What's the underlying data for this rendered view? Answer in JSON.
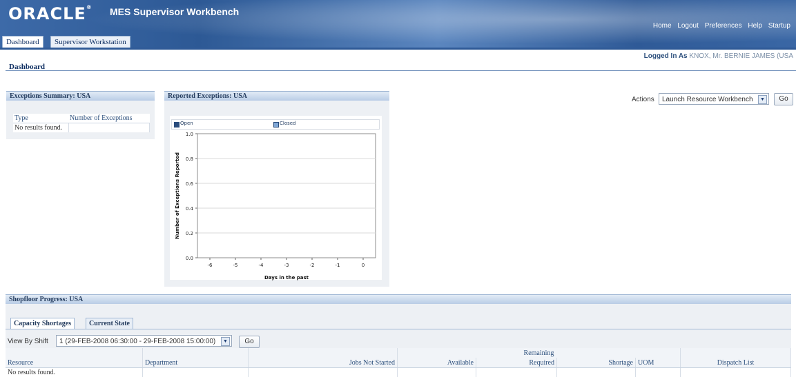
{
  "header": {
    "logo": "ORACLE",
    "app_title": "MES Supervisor Workbench",
    "links": [
      "Home",
      "Logout",
      "Preferences",
      "Help",
      "Startup"
    ]
  },
  "tabs": [
    {
      "label": "Dashboard"
    },
    {
      "label": "Supervisor Workstation"
    }
  ],
  "logged_in": {
    "label": "Logged In As",
    "user": "KNOX, Mr. BERNIE JAMES (USA"
  },
  "page_title": "Dashboard",
  "actions": {
    "label": "Actions",
    "selected": "Launch Resource Workbench",
    "go": "Go"
  },
  "exceptions_summary": {
    "title": "Exceptions Summary: USA",
    "columns": [
      "Type",
      "Number of Exceptions"
    ],
    "empty": "No results found."
  },
  "reported_exceptions": {
    "title": "Reported Exceptions: USA"
  },
  "chart_data": {
    "type": "line",
    "legend": [
      "Open",
      "Closed"
    ],
    "series": [
      {
        "name": "Open",
        "values": []
      },
      {
        "name": "Closed",
        "values": []
      }
    ],
    "x": [
      -6,
      -5,
      -4,
      -3,
      -2,
      -1,
      0
    ],
    "x_tick_labels": [
      "-6",
      "-5",
      "-4",
      "-3",
      "-2",
      "-1",
      "0"
    ],
    "y_tick_labels": [
      "0.0",
      "0.2",
      "0.4",
      "0.6",
      "0.8",
      "1.0"
    ],
    "ylim": [
      0.0,
      1.0
    ],
    "xlabel": "Days in the past",
    "ylabel": "Number of Exceptions Reported",
    "grid": true,
    "legend_position": "top"
  },
  "shopfloor": {
    "title": "Shopfloor Progress: USA",
    "subtabs": [
      "Capacity Shortages",
      "Current State"
    ],
    "shift_label": "View By Shift",
    "shift_selected": "1 (29-FEB-2008 06:30:00 - 29-FEB-2008 15:00:00)",
    "go": "Go",
    "group_header": "Remaining",
    "columns": [
      "Resource",
      "Department",
      "Jobs Not Started",
      "Available",
      "Required",
      "Shortage",
      "UOM",
      "Dispatch List"
    ],
    "empty": "No results found."
  },
  "colors": {
    "brand_blue": "#2f5a97",
    "link_blue": "#2c4f7c",
    "panel": "#edf0f4"
  }
}
